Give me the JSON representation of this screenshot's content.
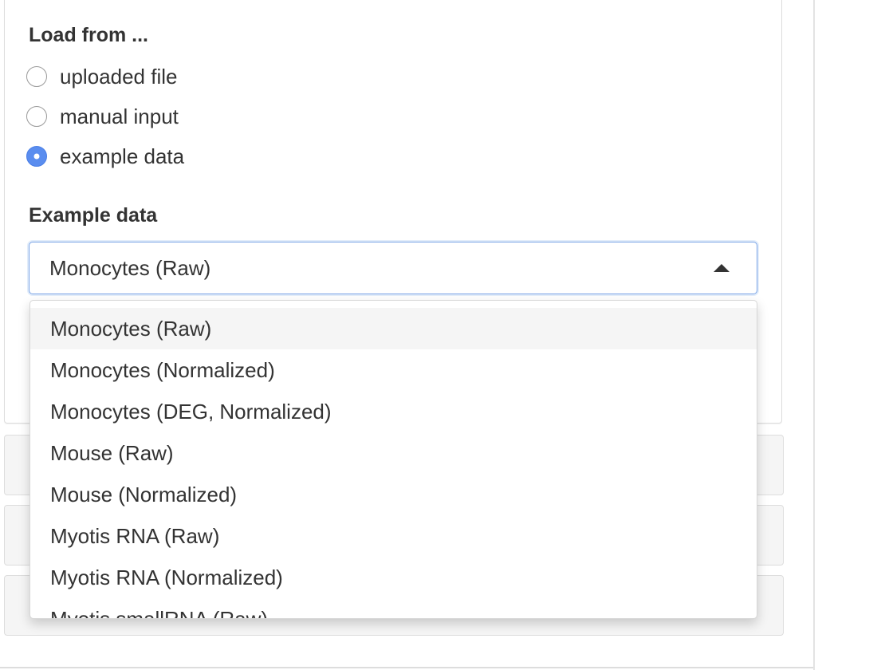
{
  "load_from": {
    "title": "Load from ...",
    "options": [
      {
        "label": "uploaded file",
        "checked": false
      },
      {
        "label": "manual input",
        "checked": false
      },
      {
        "label": "example data",
        "checked": true
      }
    ]
  },
  "example_data": {
    "title": "Example data",
    "selected": "Monocytes (Raw)",
    "options": [
      "Monocytes (Raw)",
      "Monocytes (Normalized)",
      "Monocytes (DEG, Normalized)",
      "Mouse (Raw)",
      "Mouse (Normalized)",
      "Myotis RNA (Raw)",
      "Myotis RNA (Normalized)",
      "Myotis smallRNA (Raw)"
    ]
  },
  "colors": {
    "accent": "#5a8def",
    "focus_border": "#79a3e6",
    "highlight": "#f5f5f5"
  }
}
